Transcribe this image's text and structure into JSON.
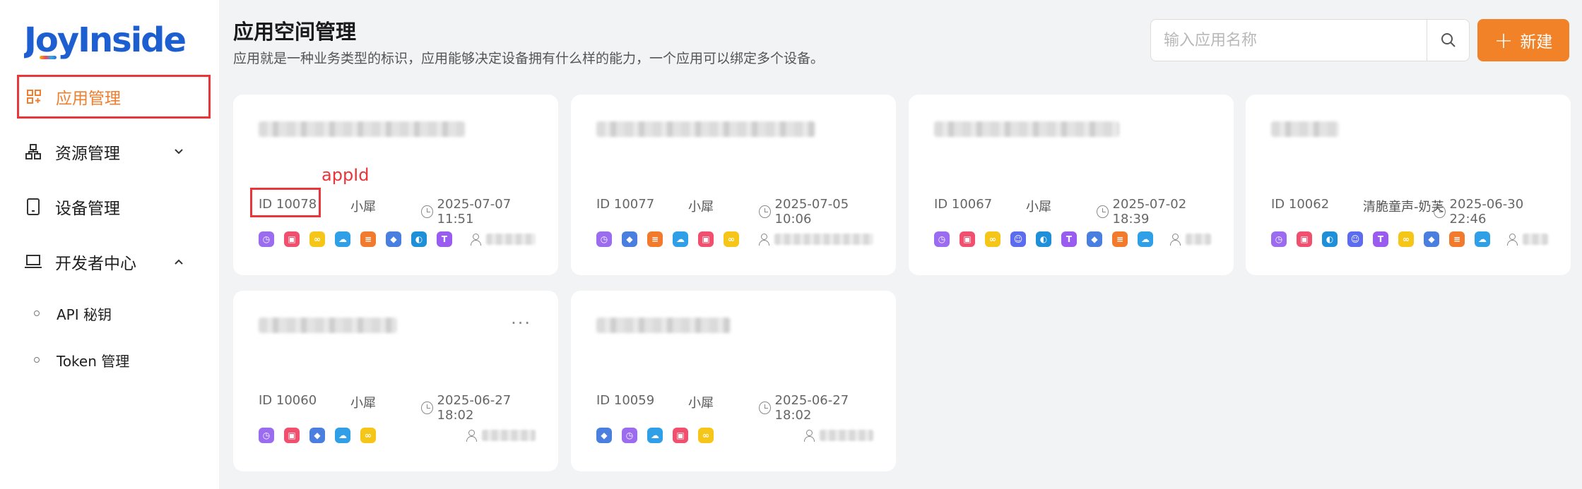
{
  "app": {
    "logo_text": "JoyInside"
  },
  "sidebar": {
    "items": [
      {
        "label": "应用管理",
        "icon": "apps-grid-icon",
        "active": true
      },
      {
        "label": "资源管理",
        "icon": "resource-tree-icon",
        "expanded": false
      },
      {
        "label": "设备管理",
        "icon": "device-tablet-icon"
      },
      {
        "label": "开发者中心",
        "icon": "laptop-icon",
        "expanded": true
      }
    ],
    "sub_items": [
      {
        "label": "API 秘钥"
      },
      {
        "label": "Token 管理"
      }
    ]
  },
  "header": {
    "title": "应用空间管理",
    "description": "应用就是一种业务类型的标识，应用能够决定设备拥有什么样的能力，一个应用可以绑定多个设备。"
  },
  "search": {
    "placeholder": "输入应用名称",
    "value": ""
  },
  "new_button": {
    "label": "新建"
  },
  "annotation": {
    "label": "appId"
  },
  "cards": [
    {
      "id": "ID 10078",
      "device": "小犀",
      "time": "2025-07-07 11:51",
      "icons": [
        "alarm-icon",
        "screen-icon",
        "glasses-icon",
        "weather-icon",
        "chat-icon",
        "education-icon",
        "voice-icon",
        "translate-icon"
      ]
    },
    {
      "id": "ID 10077",
      "device": "小犀",
      "time": "2025-07-05 10:06",
      "icons": [
        "alarm-icon",
        "education-icon",
        "chat-icon",
        "weather-icon",
        "screen-icon",
        "glasses-icon"
      ]
    },
    {
      "id": "ID 10067",
      "device": "小犀",
      "time": "2025-07-02 18:39",
      "icons": [
        "alarm-icon",
        "screen-icon",
        "glasses-icon",
        "face-scan-icon",
        "voice-icon",
        "translate-icon",
        "education-icon",
        "chat-icon",
        "weather-icon"
      ]
    },
    {
      "id": "ID 10062",
      "device": "清脆童声-奶芙",
      "time": "2025-06-30 22:46",
      "icons": [
        "alarm-icon",
        "screen-icon",
        "voice-icon",
        "face-scan-icon",
        "translate-icon",
        "glasses-icon",
        "education-icon",
        "chat-icon",
        "weather-icon"
      ]
    },
    {
      "id": "ID 10060",
      "device": "小犀",
      "time": "2025-06-27 18:02",
      "icons": [
        "alarm-icon",
        "screen-icon",
        "education-icon",
        "weather-icon",
        "glasses-icon"
      ]
    },
    {
      "id": "ID 10059",
      "device": "小犀",
      "time": "2025-06-27 18:02",
      "icons": [
        "education-icon",
        "alarm-icon",
        "weather-icon",
        "screen-icon",
        "glasses-icon"
      ]
    }
  ],
  "colors": {
    "accent": "#f28227",
    "active_nav": "#f07e2c",
    "highlight": "#e8363b",
    "background": "#f2f3f5"
  }
}
